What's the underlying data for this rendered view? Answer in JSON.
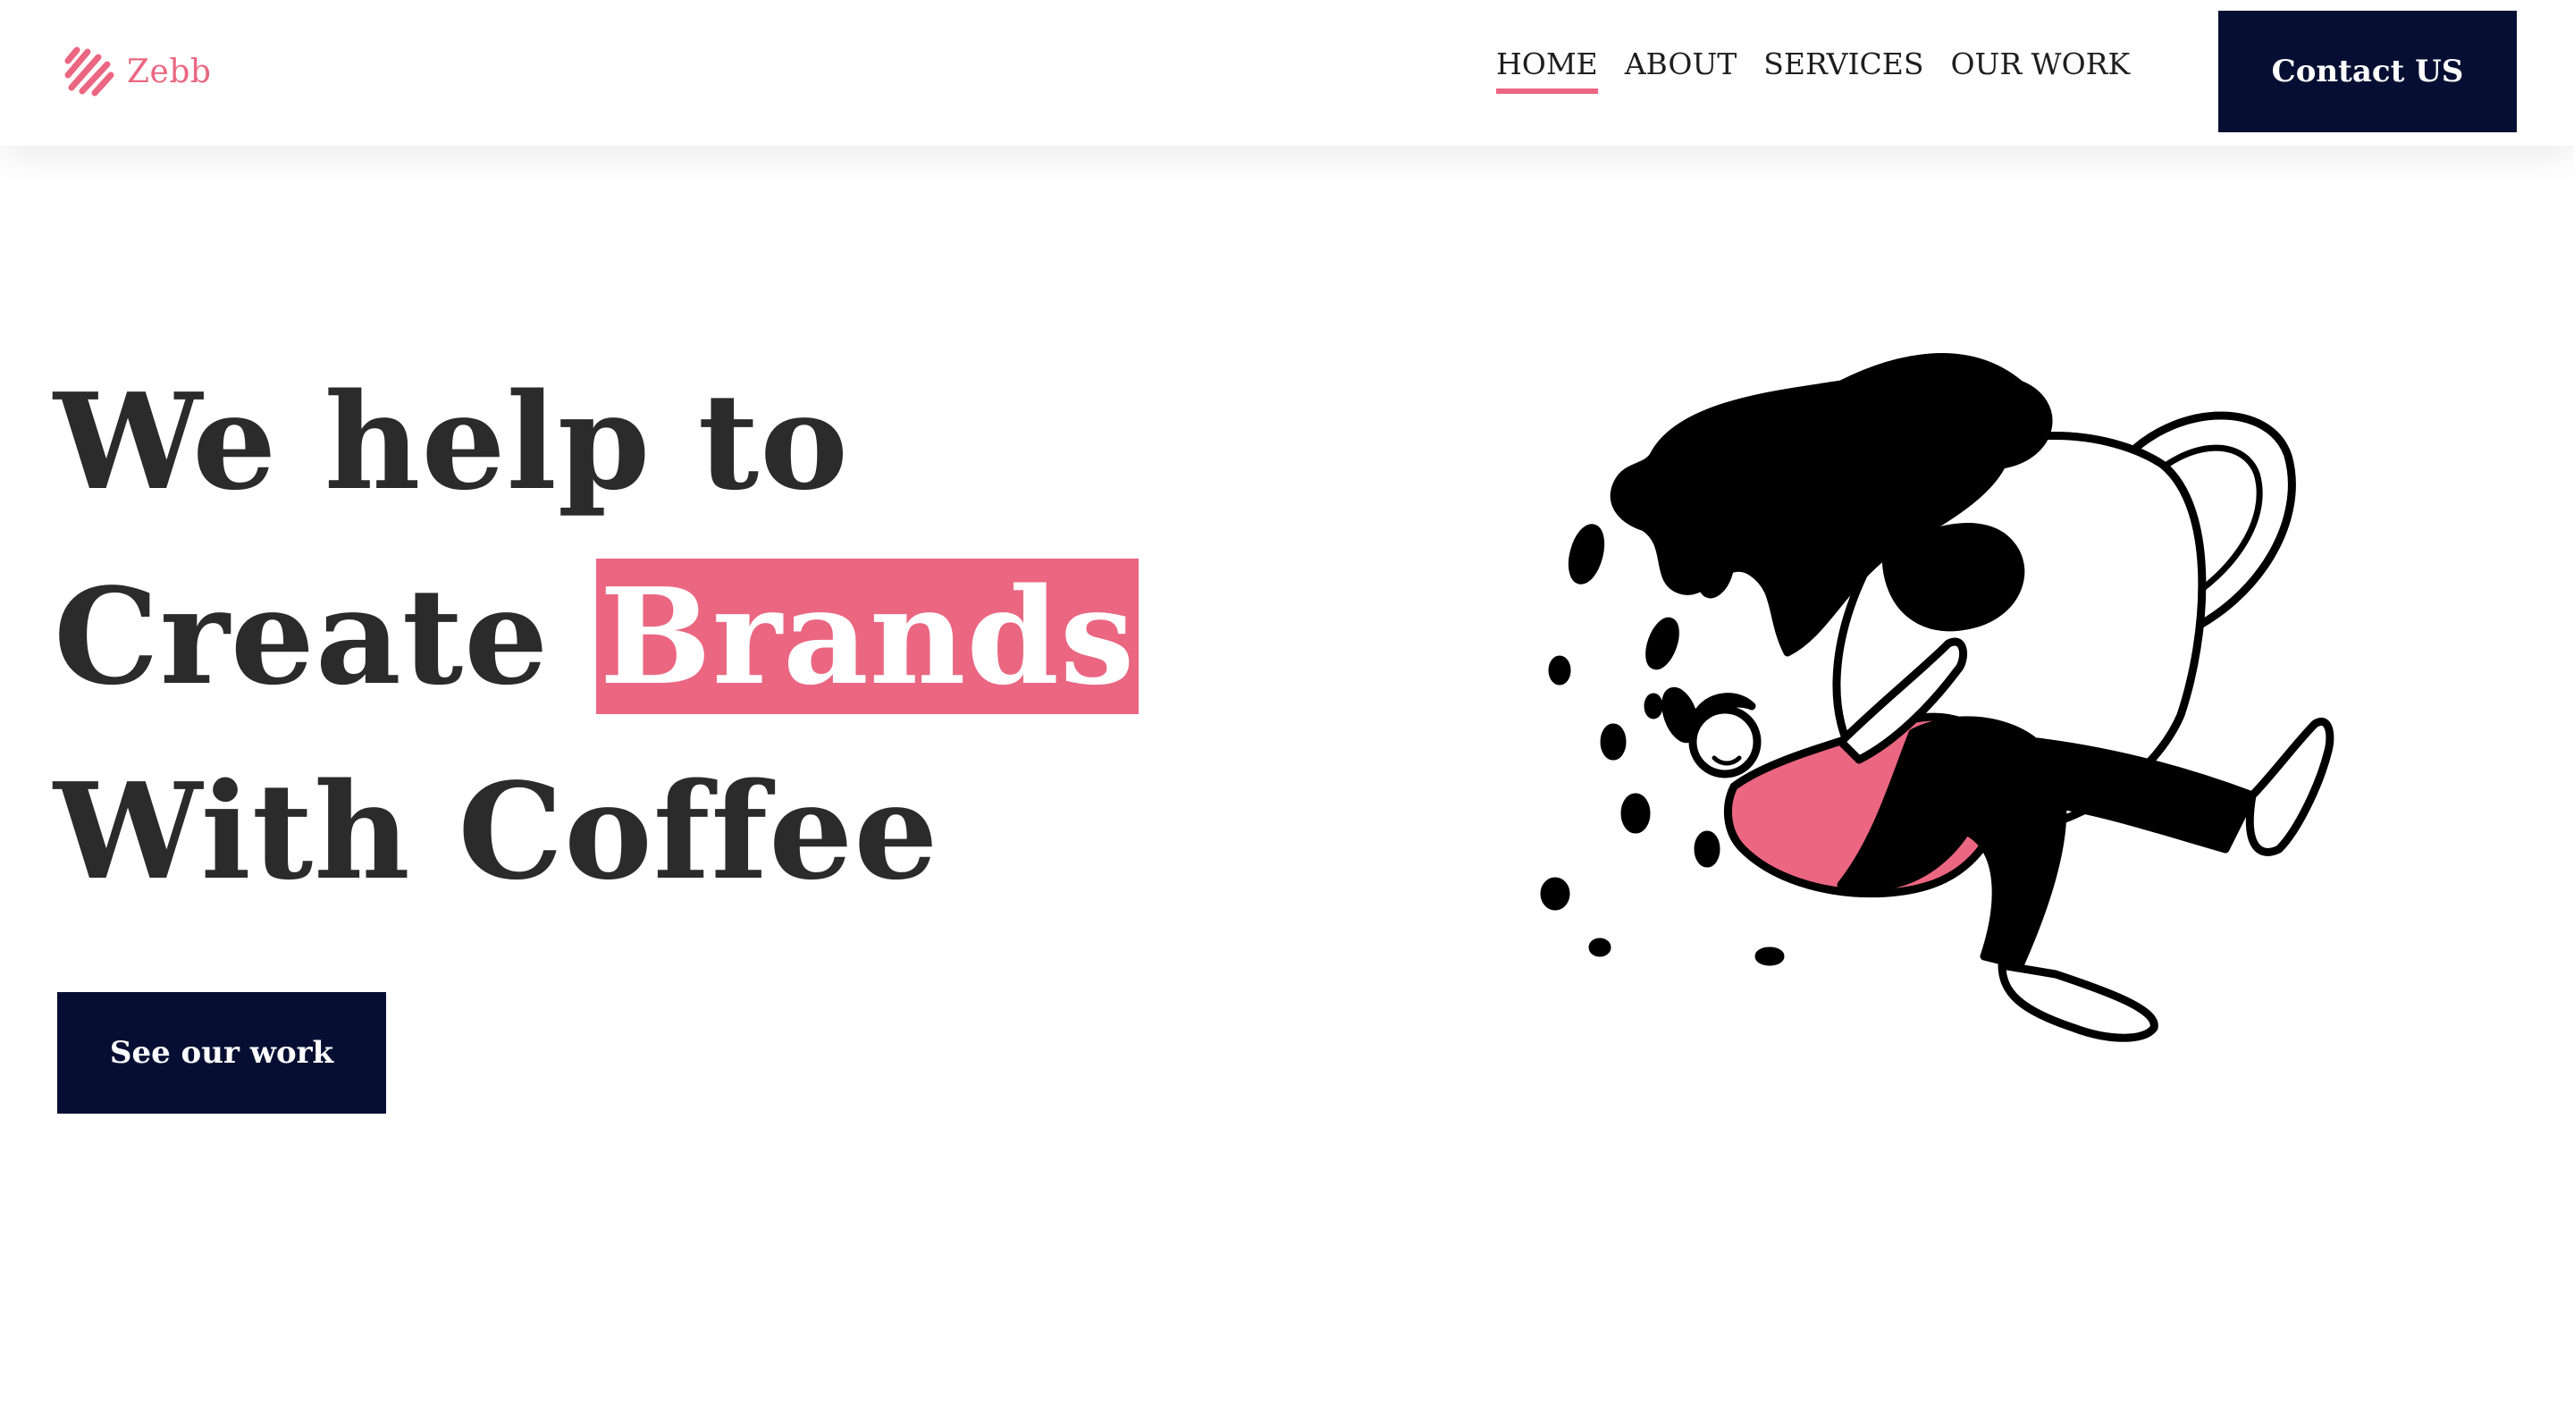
{
  "header": {
    "logo_text": "Zebb",
    "logo_icon": "zebb-stripes-logo-icon",
    "nav": [
      {
        "label": "HOME",
        "active": true
      },
      {
        "label": "ABOUT",
        "active": false
      },
      {
        "label": "SERVICES",
        "active": false
      },
      {
        "label": "OUR WORK",
        "active": false
      }
    ],
    "contact_label": "Contact US"
  },
  "hero": {
    "line1": "We help to",
    "line2_prefix": "Create ",
    "line2_highlight": "Brands",
    "line3": "With Coffee",
    "cta_label": "See our work",
    "illustration": "person-hugging-spilling-coffee-cup-illustration"
  },
  "colors": {
    "accent": "#eb6681",
    "dark_navy": "#060f33",
    "text": "#2b2b2b",
    "background": "#ffffff"
  }
}
